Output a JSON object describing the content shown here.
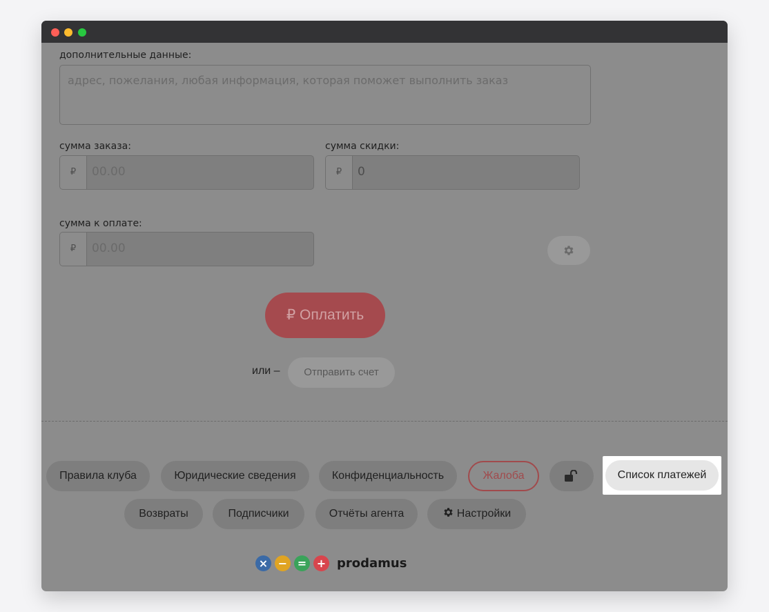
{
  "form": {
    "extra_label": "дополнительные данные:",
    "extra_placeholder": "адрес, пожелания, любая информация, которая поможет выполнить заказ",
    "order_sum_label": "сумма заказа:",
    "order_sum_currency": "₽",
    "order_sum_placeholder": "00.00",
    "discount_label": "сумма скидки:",
    "discount_currency": "₽",
    "discount_value": "0",
    "to_pay_label": "сумма к оплате:",
    "to_pay_currency": "₽",
    "to_pay_placeholder": "00.00",
    "pay_button": "₽ Оплатить",
    "or_text": "или –",
    "send_invoice_button": "Отправить счет"
  },
  "footer": {
    "row1": [
      "Правила клуба",
      "Юридические сведения",
      "Конфиденциальность",
      "Жалоба"
    ],
    "payments_list": "Список платежей",
    "row2": [
      "Возвраты",
      "Подписчики",
      "Отчёты агента",
      "Настройки"
    ],
    "brand": "prodamus"
  },
  "colors": {
    "overlay": "#8c8c8c",
    "pay_button": "#a54a4e",
    "complaint": "#a14a4c",
    "logo_blue": "#3b6aa6",
    "logo_yellow": "#e0a422",
    "logo_green": "#3aa35a",
    "logo_red": "#d8454d"
  },
  "icons": [
    "gear-icon",
    "lock-open-icon",
    "logo-x-icon",
    "logo-minus-icon",
    "logo-equals-icon",
    "logo-plus-icon"
  ]
}
